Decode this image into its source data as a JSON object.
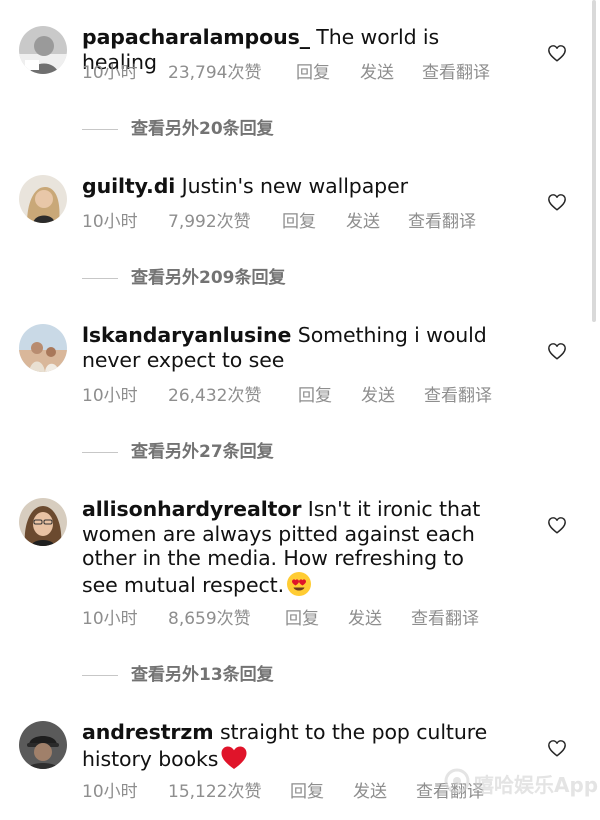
{
  "comments": [
    {
      "username": "papacharalampous_",
      "text": "The world is healing",
      "time": "10小时",
      "likes": "23,794次赞",
      "reply": "回复",
      "send": "发送",
      "translate": "查看翻译",
      "view_replies": "查看另外20条回复"
    },
    {
      "username": "guilty.di",
      "text": "Justin's new wallpaper",
      "time": "10小时",
      "likes": "7,992次赞",
      "reply": "回复",
      "send": "发送",
      "translate": "查看翻译",
      "view_replies": "查看另外209条回复"
    },
    {
      "username": "lskandaryanlusine",
      "text": "Something i would never expect to see",
      "time": "10小时",
      "likes": "26,432次赞",
      "reply": "回复",
      "send": "发送",
      "translate": "查看翻译",
      "view_replies": "查看另外27条回复"
    },
    {
      "username": "allisonhardyrealtor",
      "text": "Isn't it ironic that women are always pitted against each other in the media. How refreshing to see mutual respect.",
      "emoji": "heart-eyes-emoji",
      "time": "10小时",
      "likes": "8,659次赞",
      "reply": "回复",
      "send": "发送",
      "translate": "查看翻译",
      "view_replies": "查看另外13条回复"
    },
    {
      "username": "andrestrzm",
      "text": "straight to the pop culture history books",
      "emoji": "red-heart-emoji",
      "time": "10小时",
      "likes": "15,122次赞",
      "reply": "回复",
      "send": "发送",
      "translate": "查看翻译"
    }
  ],
  "icons": {
    "like": "heart-outline-icon"
  },
  "watermark": {
    "text": "嘻哈娱乐App"
  },
  "colors": {
    "text": "#111111",
    "meta": "#8e8e8e",
    "replies": "#737373",
    "heart_emoji": "#e0142a"
  }
}
